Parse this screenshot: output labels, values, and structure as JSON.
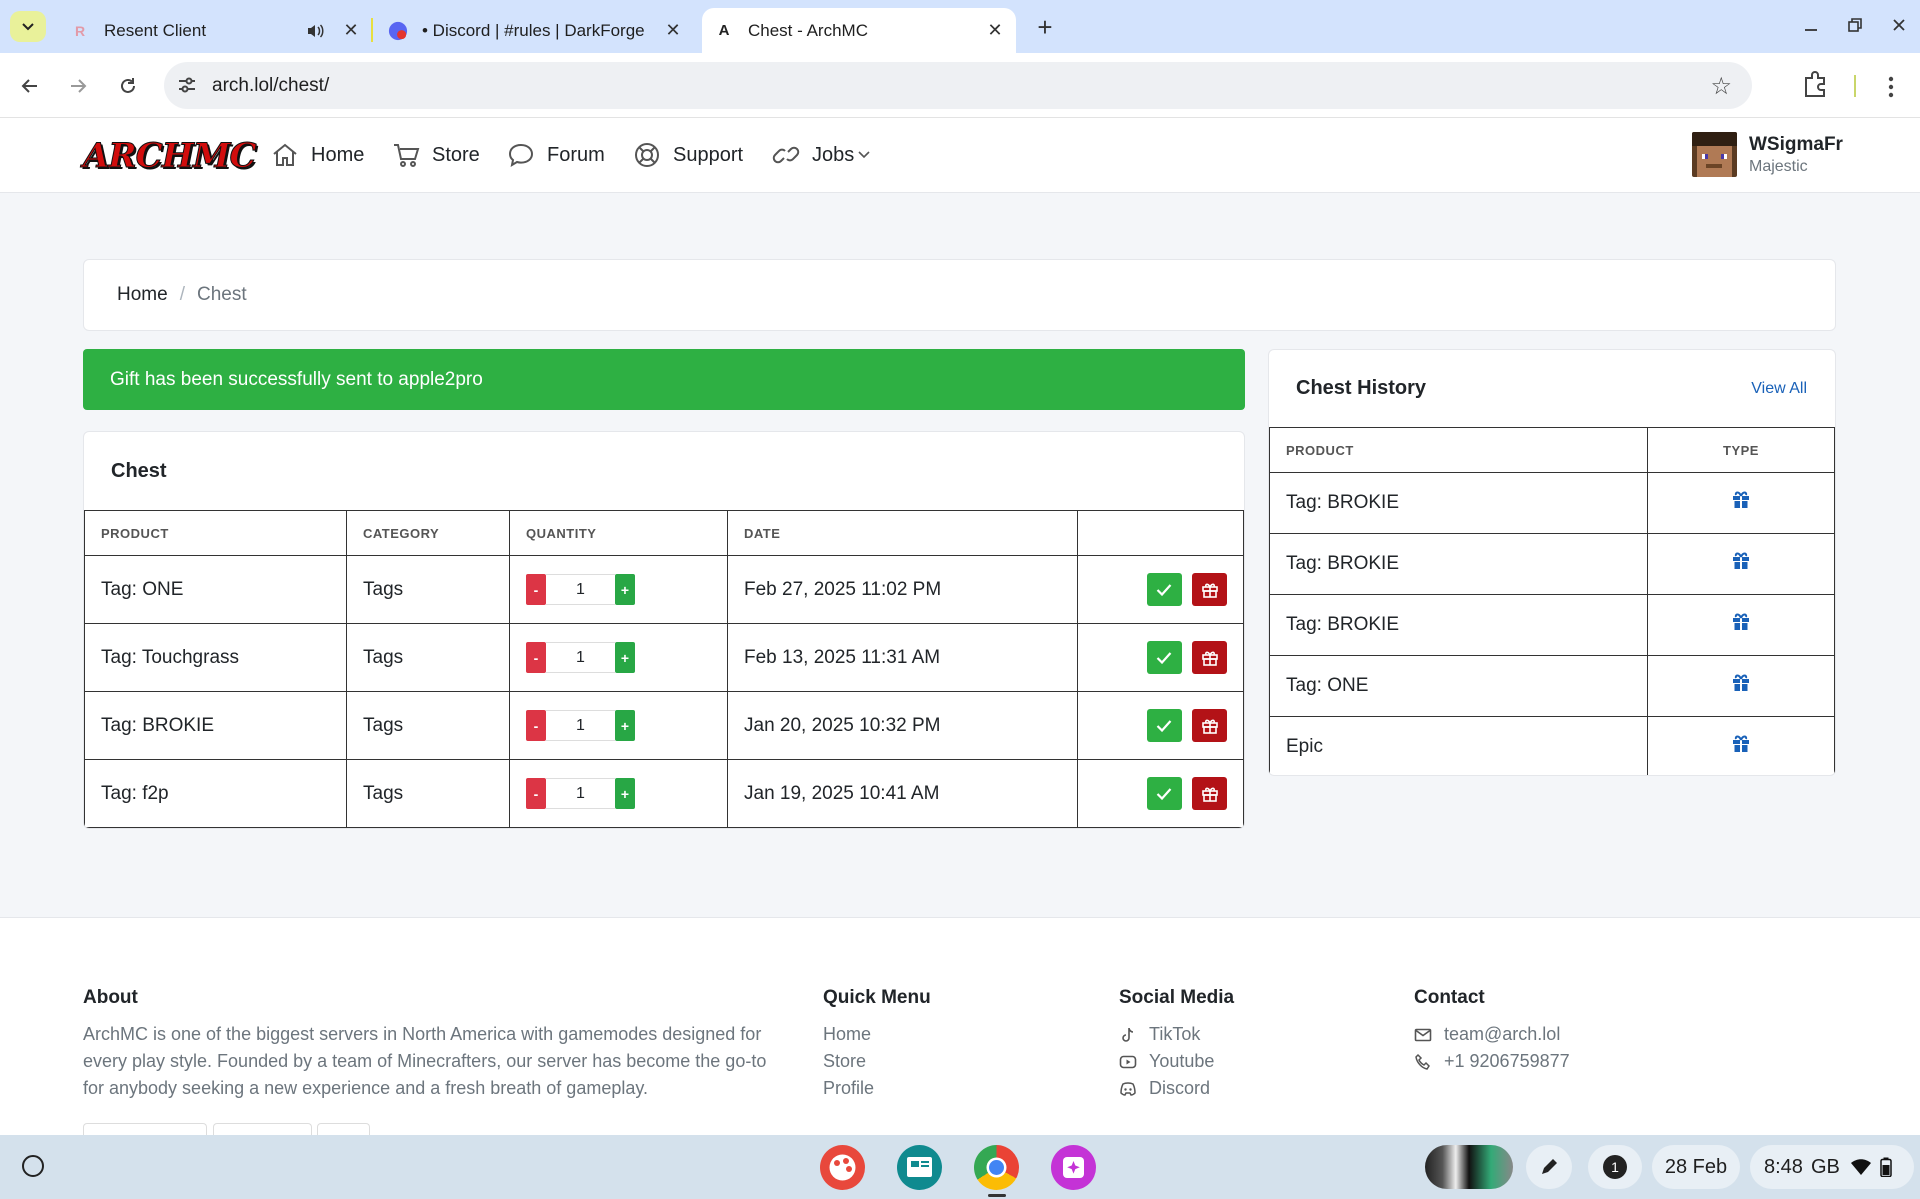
{
  "browser": {
    "tabs": [
      {
        "title": "Resent Client",
        "active": false
      },
      {
        "title": "• Discord | #rules | DarkForge",
        "active": false
      },
      {
        "title": "Chest - ArchMC",
        "active": true
      }
    ],
    "url": "arch.lol/chest/"
  },
  "site": {
    "logo": "ARCHMC",
    "nav": [
      {
        "label": "Home",
        "icon": "home-icon"
      },
      {
        "label": "Store",
        "icon": "cart-icon"
      },
      {
        "label": "Forum",
        "icon": "chat-icon"
      },
      {
        "label": "Support",
        "icon": "lifebuoy-icon"
      },
      {
        "label": "Jobs",
        "icon": "link-icon"
      }
    ],
    "user": {
      "name": "WSigmaFr",
      "rank": "Majestic"
    }
  },
  "breadcrumb": {
    "home": "Home",
    "separator": "/",
    "current": "Chest"
  },
  "alert": {
    "message": "Gift has been successfully sent to apple2pro",
    "color": "#2eb043"
  },
  "chest": {
    "title": "Chest",
    "columns": [
      "Product",
      "Category",
      "Quantity",
      "Date",
      ""
    ],
    "rows": [
      {
        "product": "Tag: ONE",
        "category": "Tags",
        "quantity": "1",
        "date": "Feb 27, 2025 11:02 PM"
      },
      {
        "product": "Tag: Touchgrass",
        "category": "Tags",
        "quantity": "1",
        "date": "Feb 13, 2025 11:31 AM"
      },
      {
        "product": "Tag: BROKIE",
        "category": "Tags",
        "quantity": "1",
        "date": "Jan 20, 2025 10:32 PM"
      },
      {
        "product": "Tag: f2p",
        "category": "Tags",
        "quantity": "1",
        "date": "Jan 19, 2025 10:41 AM"
      }
    ],
    "minus_label": "-",
    "plus_label": "+"
  },
  "history": {
    "title": "Chest History",
    "view_all": "View All",
    "columns": [
      "Product",
      "Type"
    ],
    "rows": [
      {
        "product": "Tag: BROKIE",
        "type_icon": "gift-icon"
      },
      {
        "product": "Tag: BROKIE",
        "type_icon": "gift-icon"
      },
      {
        "product": "Tag: BROKIE",
        "type_icon": "gift-icon"
      },
      {
        "product": "Tag: ONE",
        "type_icon": "gift-icon"
      },
      {
        "product": "Epic",
        "type_icon": "gift-icon"
      }
    ]
  },
  "footer": {
    "about": {
      "title": "About",
      "text": "ArchMC is one of the biggest servers in North America with gamemodes designed for every play style. Founded by a team of Minecrafters, our server has become the go-to for anybody seeking a new experience and a fresh breath of gameplay."
    },
    "quick_menu": {
      "title": "Quick Menu",
      "links": [
        "Home",
        "Store",
        "Profile"
      ]
    },
    "social": {
      "title": "Social Media",
      "links": [
        {
          "label": "TikTok",
          "icon": "tiktok-icon"
        },
        {
          "label": "Youtube",
          "icon": "youtube-icon"
        },
        {
          "label": "Discord",
          "icon": "discord-icon"
        }
      ]
    },
    "contact": {
      "title": "Contact",
      "email": "team@arch.lol",
      "phone": "+1 9206759877"
    }
  },
  "shelf": {
    "notification_count": "1",
    "date": "28 Feb",
    "time": "8:48",
    "locale": "GB"
  },
  "colors": {
    "primary_link": "#1961b8",
    "success": "#2eb043",
    "danger": "#b31217",
    "gift_icon": "#1961b8"
  }
}
